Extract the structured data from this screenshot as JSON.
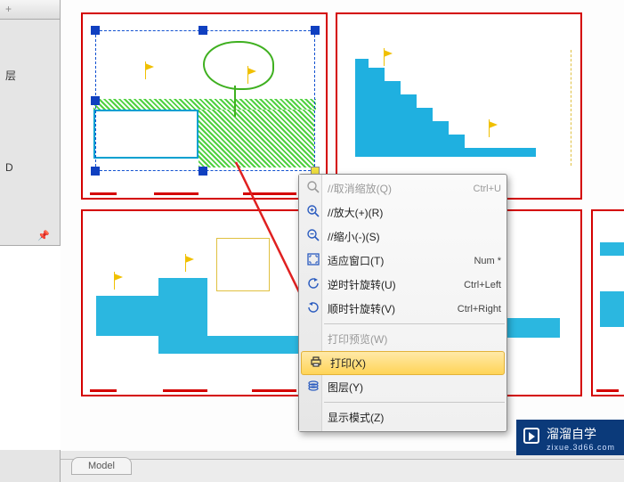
{
  "left_panel": {
    "item1": "层",
    "item2": "D"
  },
  "context_menu": {
    "cancel_zoom": {
      "label": "//取消缩放(Q)",
      "shortcut": "Ctrl+U"
    },
    "zoom_in": {
      "label": "//放大(+)(R)"
    },
    "zoom_out": {
      "label": "//缩小(-)(S)"
    },
    "fit_window": {
      "label": "适应窗口(T)",
      "shortcut": "Num *"
    },
    "rotate_ccw": {
      "label": "逆时针旋转(U)",
      "shortcut": "Ctrl+Left"
    },
    "rotate_cw": {
      "label": "顺时针旋转(V)",
      "shortcut": "Ctrl+Right"
    },
    "print_preview": {
      "label": "打印预览(W)"
    },
    "print": {
      "label": "打印(X)"
    },
    "layers": {
      "label": "图层(Y)"
    },
    "display_mode": {
      "label": "显示模式(Z)"
    }
  },
  "tabs": {
    "model": "Model"
  },
  "watermark": {
    "title": "溜溜自学",
    "sub": "zixue.3d66.com"
  }
}
